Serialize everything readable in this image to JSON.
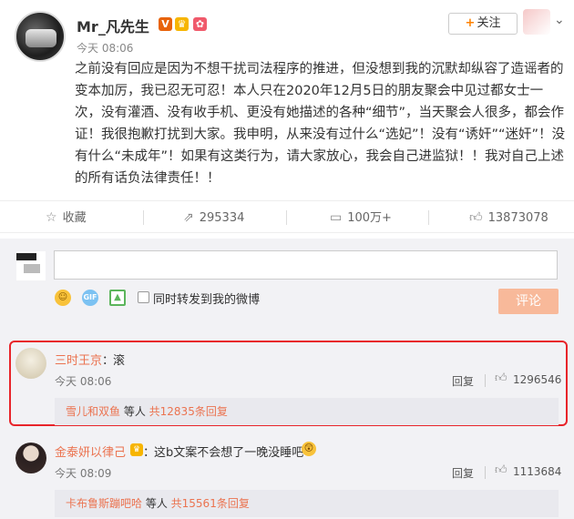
{
  "post": {
    "username": "Mr_凡先生",
    "badges": [
      "verified-v-icon",
      "crown-badge-icon",
      "gift-badge-icon"
    ],
    "time": "今天 08:06",
    "follow_label": "关注",
    "body": "之前没有回应是因为不想干扰司法程序的推进，但没想到我的沉默却纵容了造谣者的变本加厉，我已忍无可忍！本人只在2020年12月5日的朋友聚会中见过都女士一次，没有灌酒、没有收手机、更没有她描述的各种“细节”，当天聚会人很多，都会作证！我很抱歉打扰到大家。我申明，从来没有过什么“选妃”！没有“诱奸”“迷奸”！没有什么“未成年”！如果有这类行为，请大家放心，我会自己进监狱！！我对自己上述的所有话负法律责任！！"
  },
  "actions": {
    "favorite_label": "收藏",
    "repost_count": "295334",
    "comment_count": "100万+",
    "like_count": "13873078"
  },
  "composer": {
    "input_value": "",
    "repost_label": "同时转发到我的微博",
    "submit_label": "评论",
    "tools": [
      "emoji-icon",
      "gif-icon",
      "image-icon"
    ]
  },
  "comments": [
    {
      "username": "三时王京",
      "separator": "：",
      "text": "滚",
      "time": "今天 08:06",
      "reply_label": "回复",
      "likes": "1296546",
      "sub_user": "雪儿和双鱼",
      "sub_mid": " 等人 ",
      "sub_count": "共12835条回复",
      "highlighted": true
    },
    {
      "username": "金泰妍以律己",
      "separator": "：",
      "text": "这b文案不会想了一晚没睡吧",
      "time": "今天 08:09",
      "reply_label": "回复",
      "likes": "1113684",
      "sub_user": "卡布鲁斯蹦吧哈",
      "sub_mid": " 等人 ",
      "sub_count": "共15561条回复",
      "highlighted": false
    }
  ],
  "colors": {
    "accent": "#ff8200",
    "username_link": "#eb7350",
    "highlight_border": "#e8242a",
    "submit_disabled": "#f8b99a"
  }
}
